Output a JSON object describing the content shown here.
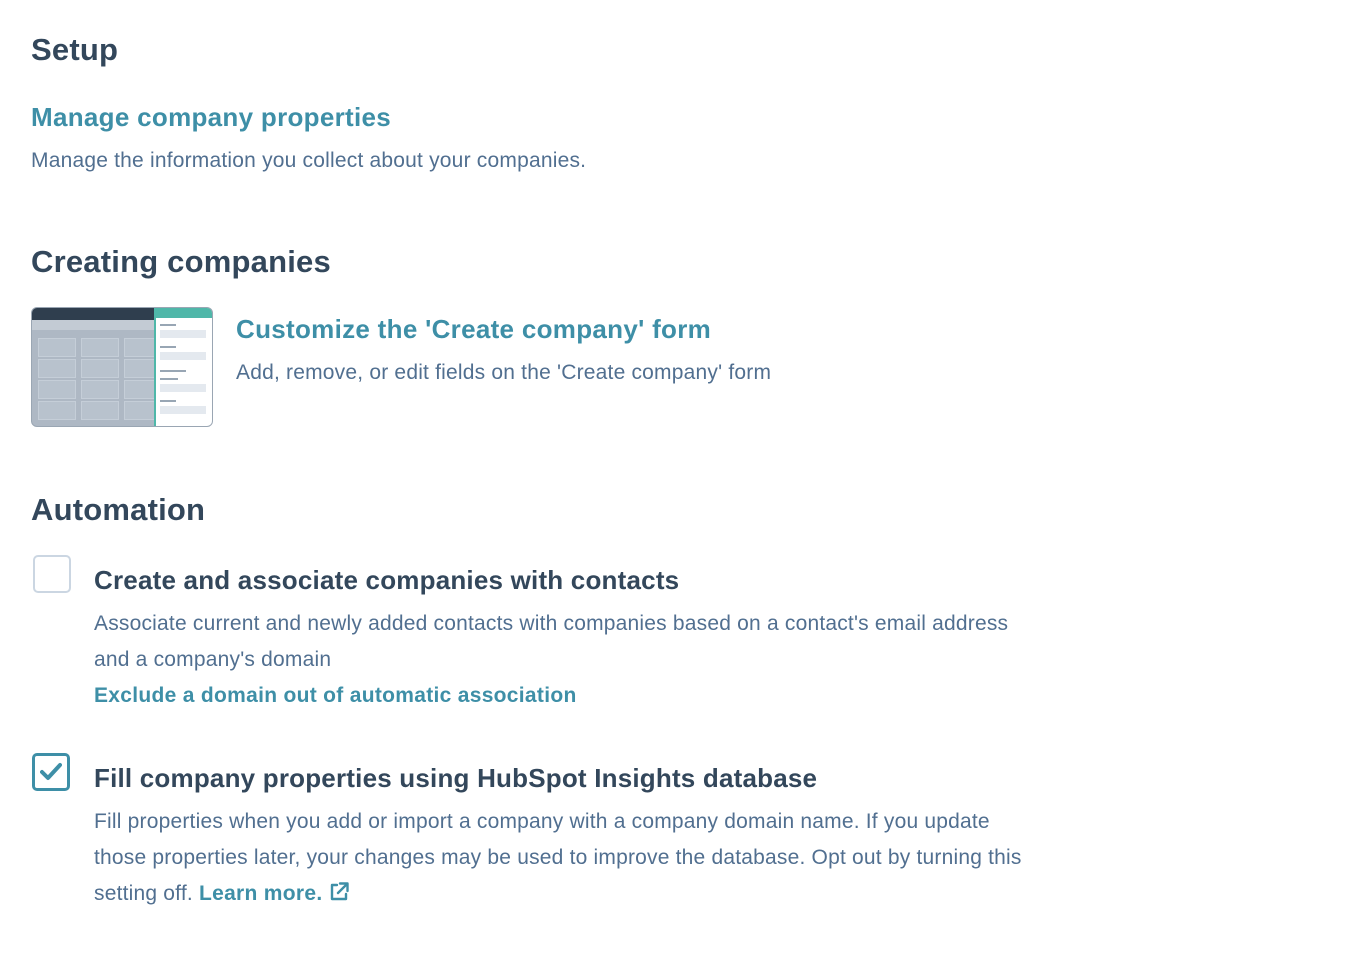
{
  "setup": {
    "title": "Setup",
    "manage_link": "Manage company properties",
    "manage_desc": "Manage the information you collect about your companies."
  },
  "creating": {
    "title": "Creating companies",
    "customize_link": "Customize the 'Create company' form",
    "customize_desc": "Add, remove, or edit fields on the 'Create company' form"
  },
  "automation": {
    "title": "Automation",
    "options": [
      {
        "title": "Create and associate companies with contacts",
        "checked": false,
        "desc_line1": "Associate current and newly added contacts with companies based on a contact's email address",
        "desc_line2": "and a company's domain",
        "link": "Exclude a domain out of automatic association"
      },
      {
        "title": "Fill company properties using HubSpot Insights database",
        "checked": true,
        "desc_line1": "Fill properties when you add or import a company with a company domain name. If you update",
        "desc_line2": "those properties later, your changes may be used to improve the database. Opt out by turning this",
        "desc_line3": "setting off.",
        "link": "Learn more."
      }
    ]
  },
  "colors": {
    "link": "#3e8fa7",
    "heading": "#33475b",
    "body": "#516f90",
    "checkbox_border": "#cbd6e2"
  },
  "icons": {
    "checkmark": "check-icon",
    "external": "external-link-icon"
  }
}
